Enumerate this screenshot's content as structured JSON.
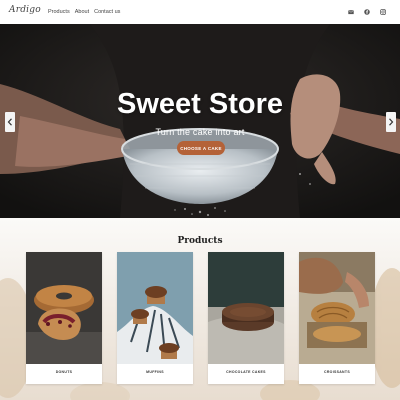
{
  "header": {
    "logo": "Ardigo",
    "nav": [
      "Products",
      "About",
      "Contact us"
    ],
    "social_icons": [
      "email-icon",
      "facebook-icon",
      "instagram-icon"
    ]
  },
  "hero": {
    "title": "Sweet Store",
    "subtitle": "Turn the cake into art",
    "cta_label": "CHOOSE A CAKE",
    "cta_color": "#b46238"
  },
  "products": {
    "title": "Products",
    "cards": [
      {
        "label": "DONUTS"
      },
      {
        "label": "MUFFINS"
      },
      {
        "label": "CHOCOLATE CAKES"
      },
      {
        "label": "CROISSANTS"
      }
    ]
  }
}
